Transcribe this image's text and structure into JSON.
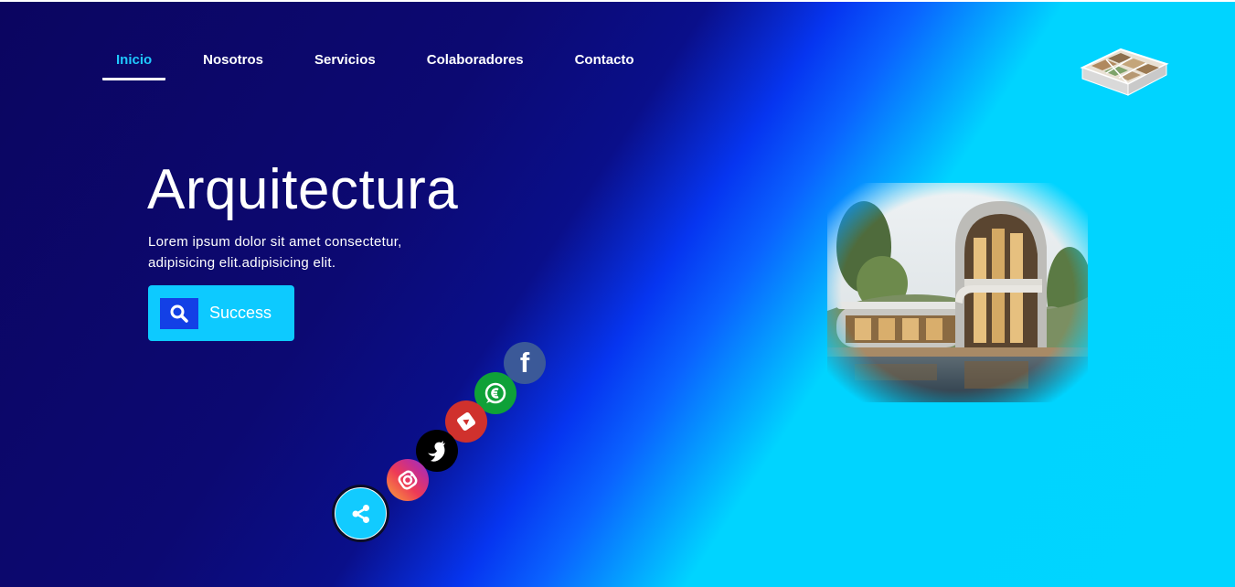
{
  "nav": {
    "items": [
      {
        "label": "Inicio",
        "active": true
      },
      {
        "label": "Nosotros",
        "active": false
      },
      {
        "label": "Servicios",
        "active": false
      },
      {
        "label": "Colaboradores",
        "active": false
      },
      {
        "label": "Contacto",
        "active": false
      }
    ]
  },
  "logo": {
    "icon": "house-floorplan-3d-logo"
  },
  "hero": {
    "title": "Arquitectura",
    "description": "Lorem ipsum dolor sit amet consectetur, adipisicing elit.adipisicing elit.",
    "button_label": "Success",
    "button_icon": "search-icon",
    "image": "modern-curved-house-photo"
  },
  "social": {
    "items": [
      {
        "name": "facebook-icon",
        "glyph": "f",
        "color": "#3b5998"
      },
      {
        "name": "whatsapp-icon",
        "color": "#0fa138"
      },
      {
        "name": "youtube-icon",
        "color": "#d0312d"
      },
      {
        "name": "twitter-icon",
        "color": "#000000"
      },
      {
        "name": "instagram-icon",
        "color": "#ee3a56"
      }
    ],
    "toggle_icon": "share-icon"
  },
  "colors": {
    "accent": "#00d5ff",
    "nav_active": "#1fc9ff",
    "dark_bg": "#0b0560",
    "button": "#0dcaff",
    "button_icon_bg": "#1340e6"
  }
}
